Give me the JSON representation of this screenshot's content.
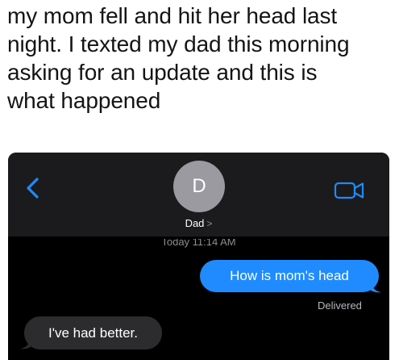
{
  "caption": "my mom fell and hit her head last\nnight. I texted my dad this morning\nasking for an update and this is\nwhat happened",
  "contact": {
    "initial": "D",
    "name": "Dad",
    "chevron": ">"
  },
  "timestamp": "Today 11:14 AM",
  "messages": [
    {
      "direction": "outgoing",
      "text": "How is mom's head"
    },
    {
      "direction": "incoming",
      "text": "I've had better."
    }
  ],
  "delivered_label": "Delivered",
  "icons": {
    "back": "chevron-left-icon",
    "video": "video-camera-icon"
  },
  "colors": {
    "outgoing_bubble": "#1f8bff",
    "incoming_bubble": "#2c2c2e",
    "header_bg": "#1b1b1d",
    "accent": "#1f8bff",
    "avatar_bg": "#9a9aa0"
  }
}
